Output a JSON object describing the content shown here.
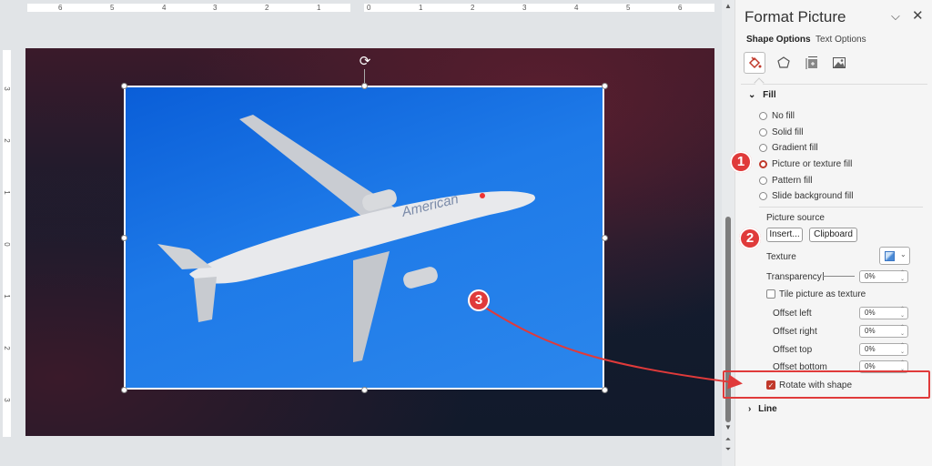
{
  "ruler": {
    "top_labels_left": [
      "6",
      "5",
      "4",
      "3",
      "2",
      "1"
    ],
    "top_labels_right": [
      "0",
      "1",
      "2",
      "3",
      "4",
      "5",
      "6"
    ],
    "left_labels": [
      "3",
      "2",
      "1",
      "0",
      "1",
      "2",
      "3"
    ]
  },
  "slide": {
    "picture_text": "American"
  },
  "annotations": {
    "step1": "1",
    "step2": "2",
    "step3": "3",
    "accent_color": "#e03a3a"
  },
  "panel": {
    "title": "Format Picture",
    "collapse_icon": "chevron-down-icon",
    "close_icon": "close-icon",
    "tabs": [
      {
        "label": "Shape Options",
        "active": true
      },
      {
        "label": "Text Options",
        "active": false
      }
    ],
    "categories": [
      "fill-line-icon",
      "effects-icon",
      "size-properties-icon",
      "picture-icon"
    ],
    "fill_section": {
      "label": "Fill",
      "options": [
        {
          "label": "No fill",
          "underline": "N",
          "selected": false
        },
        {
          "label": "Solid fill",
          "underline": "S",
          "selected": false
        },
        {
          "label": "Gradient fill",
          "underline": "G",
          "selected": false
        },
        {
          "label": "Picture or texture fill",
          "underline": "P",
          "selected": true
        },
        {
          "label": "Pattern fill",
          "underline": "a",
          "selected": false
        },
        {
          "label": "Slide background fill",
          "underline": "b",
          "selected": false
        }
      ],
      "picture_source_label": "Picture source",
      "insert_button": "Insert...",
      "clipboard_button": "Clipboard",
      "texture_label": "Texture",
      "transparency_label": "Transparency",
      "transparency_value": "0%",
      "tile_label": "Tile picture as texture",
      "tile_checked": false,
      "offsets": [
        {
          "label": "Offset left",
          "value": "0%"
        },
        {
          "label": "Offset right",
          "value": "0%"
        },
        {
          "label": "Offset top",
          "value": "0%"
        },
        {
          "label": "Offset bottom",
          "value": "0%"
        }
      ],
      "rotate_label": "Rotate with shape",
      "rotate_checked": true
    },
    "line_section": {
      "label": "Line"
    }
  }
}
